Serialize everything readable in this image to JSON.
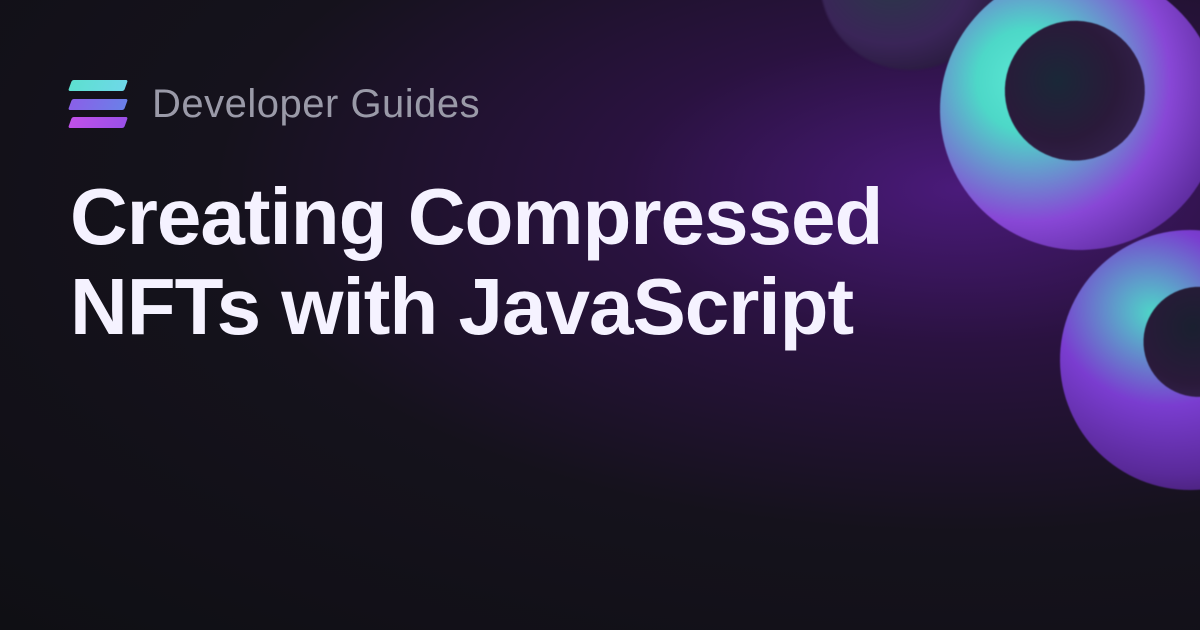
{
  "header": {
    "category": "Developer Guides"
  },
  "page": {
    "title": "Creating Compressed NFTs with JavaScript"
  }
}
